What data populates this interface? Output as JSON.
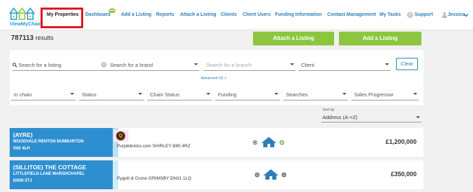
{
  "brand": {
    "logo_text": "ViewMyChain"
  },
  "nav": {
    "items": [
      {
        "label": "My Properties"
      },
      {
        "label": "Dashboard"
      },
      {
        "label": "Add a Listing"
      },
      {
        "label": "Reports"
      },
      {
        "label": "Attach a Listing"
      },
      {
        "label": "Clients"
      },
      {
        "label": "Client Users"
      },
      {
        "label": "Funding Information"
      },
      {
        "label": "Contact Management"
      },
      {
        "label": "My Tasks"
      },
      {
        "label": "Support"
      }
    ],
    "dashboard_badge": "New",
    "user": "Jessica"
  },
  "results": {
    "count": "787113",
    "suffix": "results"
  },
  "actions": {
    "attach_label": "Attach a Listing",
    "add_label": "Add a Listing"
  },
  "filters": {
    "search_listing": "Search for a listing",
    "search_brand": "Search for a brand",
    "search_branch": "Search for a branch",
    "client": "Client",
    "clear": "Clear",
    "advanced": "Advanced (0) ˄",
    "row2": [
      "In chain",
      "Status",
      "Chain Status",
      "Funding",
      "Searches",
      "Sales Progressor"
    ]
  },
  "sort": {
    "label": "Sort by",
    "value": "Address (A->Z)"
  },
  "listings": [
    {
      "name": "(AYRE)",
      "address1": "WOODVALE RENTON DUMBARTON",
      "postcode": "G82 4LH",
      "agent": "Purplebricks.com SHIRLEY B90 4RZ",
      "agent_icon": "purplebricks-logo-icon",
      "price": "£1,200,000"
    },
    {
      "name": "(SILLITOE) THE COTTAGE",
      "address1": "LITTLEFIELD LANE MARSHCHAPEL",
      "postcode": "DN36 5TJ",
      "agent": "Pygott & Crone GRIMSBY DN31 1LQ",
      "price": "£350,000"
    }
  ],
  "colors": {
    "accent_blue": "#2d7fb8",
    "card_blue": "#2e8fd0",
    "green": "#8cc63f",
    "highlight_red": "#e0161f"
  }
}
